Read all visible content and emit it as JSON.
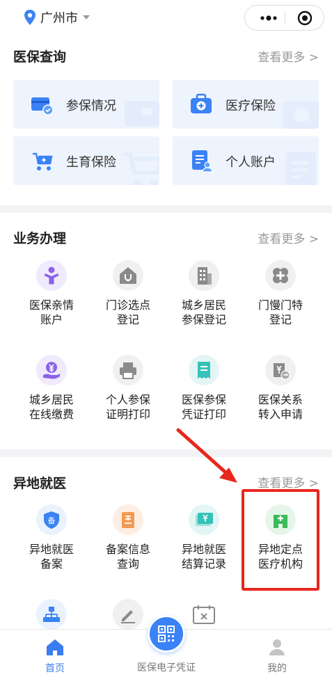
{
  "header": {
    "city": "广州市"
  },
  "sections": {
    "query": {
      "title": "医保查询",
      "more": "查看更多 >",
      "cards": [
        {
          "label": "参保情况",
          "icon": "insurance-card-icon"
        },
        {
          "label": "医疗保险",
          "icon": "medical-kit-icon"
        },
        {
          "label": "生育保险",
          "icon": "baby-stroller-icon"
        },
        {
          "label": "个人账户",
          "icon": "personal-account-icon"
        }
      ]
    },
    "business": {
      "title": "业务办理",
      "more": "查看更多 >",
      "items": [
        {
          "line1": "医保亲情",
          "line2": "账户",
          "icon": "family-icon"
        },
        {
          "line1": "门诊选点",
          "line2": "登记",
          "icon": "clinic-stethoscope-icon"
        },
        {
          "line1": "城乡居民",
          "line2": "参保登记",
          "icon": "building-icon"
        },
        {
          "line1": "门慢门特",
          "line2": "登记",
          "icon": "medical-cross-icon"
        },
        {
          "line1": "城乡居民",
          "line2": "在线缴费",
          "icon": "yuan-payment-icon"
        },
        {
          "line1": "个人参保",
          "line2": "证明打印",
          "icon": "printer-icon"
        },
        {
          "line1": "医保参保",
          "line2": "凭证打印",
          "icon": "receipt-icon"
        },
        {
          "line1": "医保关系",
          "line2": "转入申请",
          "icon": "transfer-icon"
        }
      ]
    },
    "remote": {
      "title": "异地就医",
      "more": "查看更多 >",
      "items": [
        {
          "line1": "异地就医",
          "line2": "备案",
          "icon": "filing-shield-icon"
        },
        {
          "line1": "备案信息",
          "line2": "查询",
          "icon": "record-query-icon"
        },
        {
          "line1": "异地就医",
          "line2": "结算记录",
          "icon": "settlement-bill-icon"
        },
        {
          "line1": "异地定点",
          "line2": "医疗机构",
          "icon": "hospital-icon"
        }
      ],
      "partial_icons": [
        "org-chart-icon",
        "edit-pen-icon",
        "calendar-icon"
      ]
    }
  },
  "tabbar": {
    "home": "首页",
    "voucher": "医保电子凭证",
    "mine": "我的"
  },
  "colors": {
    "accent": "#3a82f6",
    "card_bg": "#eef4fd",
    "annotation": "#e8271c"
  }
}
